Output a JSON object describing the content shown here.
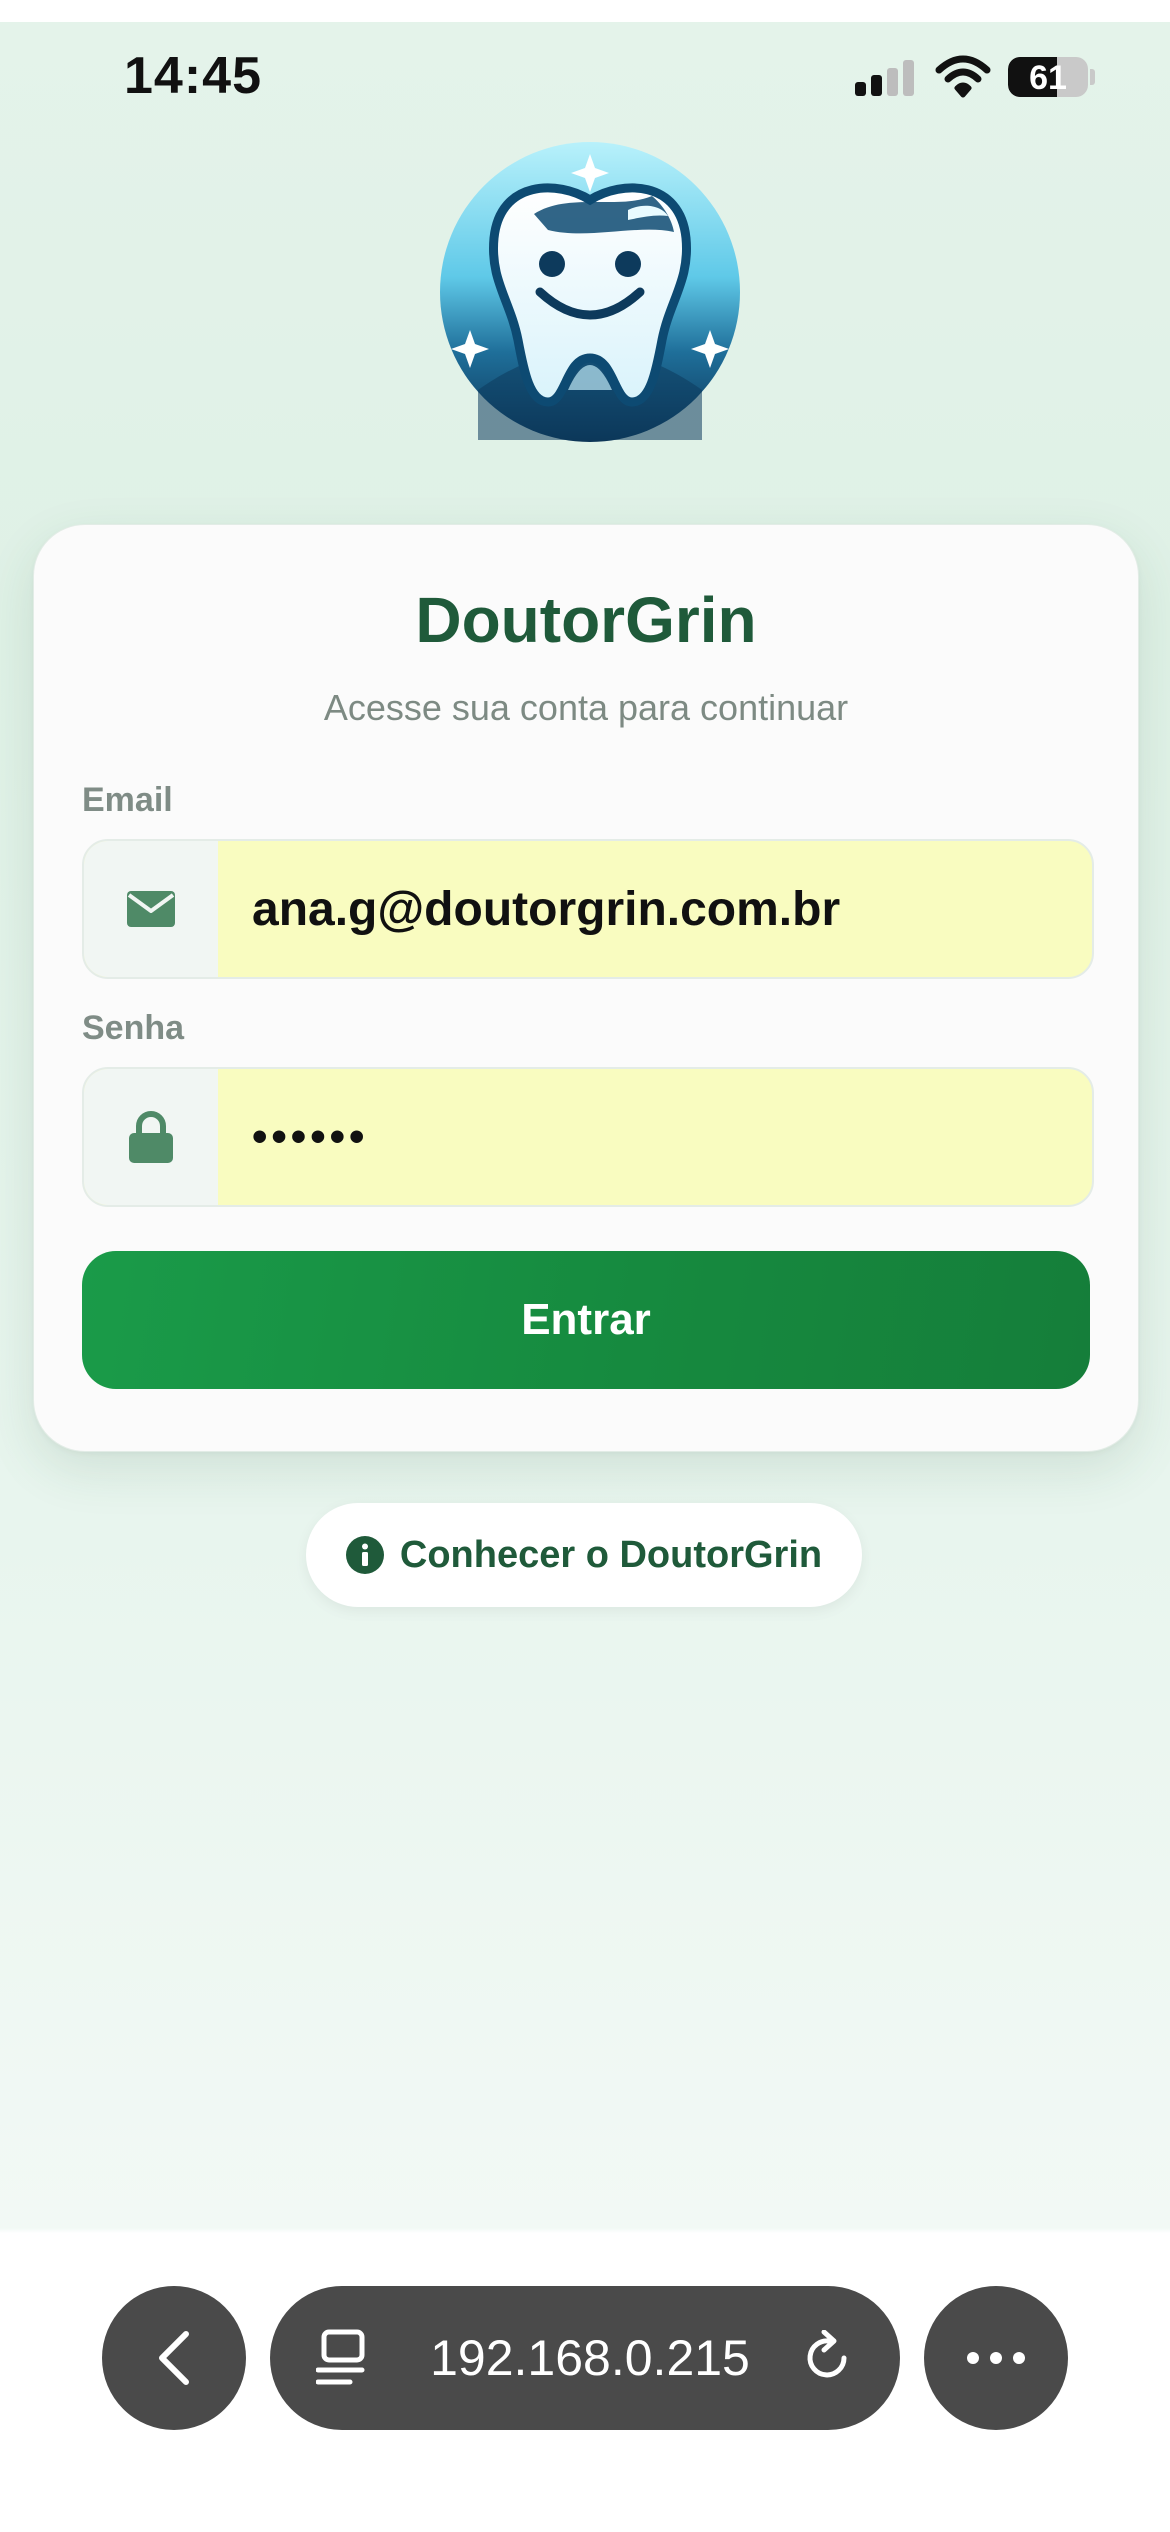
{
  "status_bar": {
    "time": "14:45",
    "battery_level": "61"
  },
  "app": {
    "name": "DoutorGrin",
    "subtitle": "Acesse sua conta para continuar"
  },
  "form": {
    "email_label": "Email",
    "email_value": "ana.g@doutorgrin.com.br",
    "password_label": "Senha",
    "password_value": "••••••",
    "submit_label": "Entrar"
  },
  "secondary": {
    "know_label": "Conhecer o DoutorGrin"
  },
  "browser": {
    "url": "192.168.0.215"
  },
  "colors": {
    "brand_green": "#1f5a3a",
    "button_green": "#1a9b49",
    "autofill_yellow": "#f9fcc0",
    "toolbar_gray": "#4a4a4a"
  },
  "icons": {
    "email": "envelope-icon",
    "password": "lock-icon",
    "info": "info-icon",
    "back": "chevron-left-icon",
    "tabs": "tabs-icon",
    "reload": "reload-icon",
    "more": "more-icon"
  }
}
